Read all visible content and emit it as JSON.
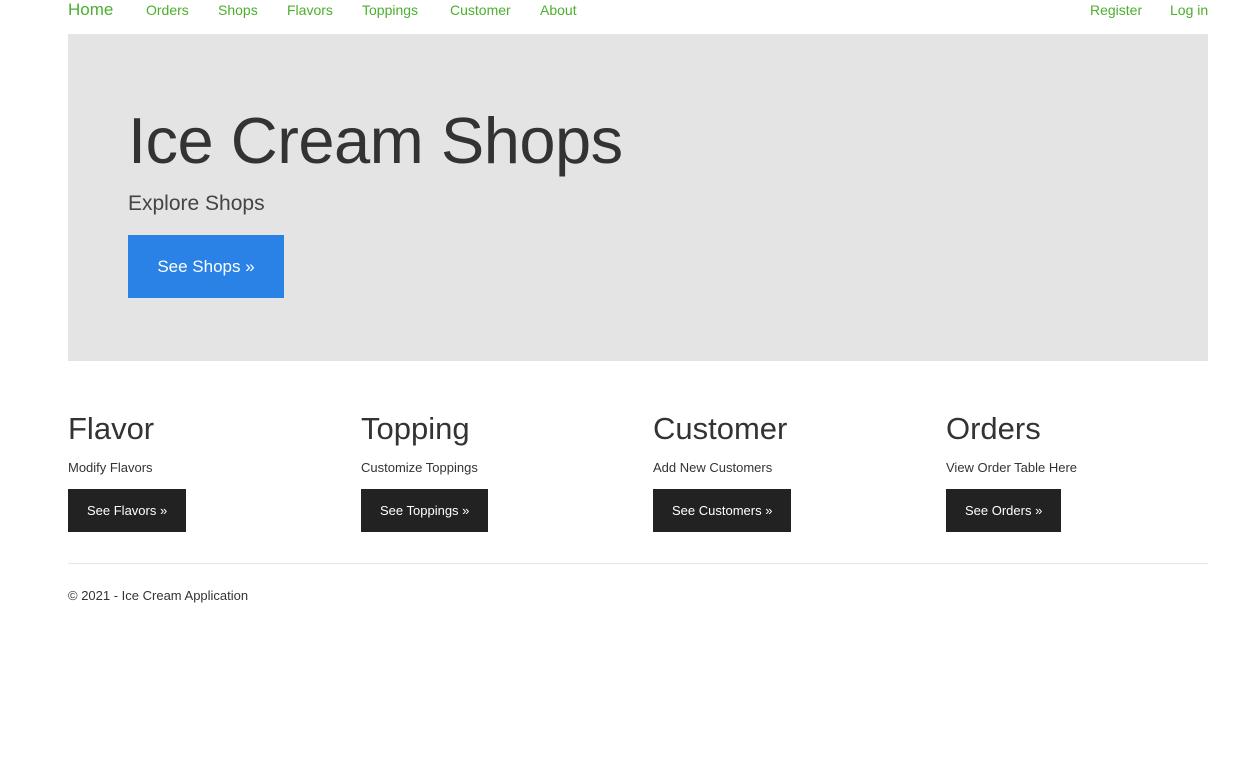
{
  "navbar": {
    "brand": "Home",
    "links": [
      "Orders",
      "Shops",
      "Flavors",
      "Toppings",
      "Customer",
      "About"
    ],
    "right_links": [
      "Register",
      "Log in"
    ],
    "link_color": "#4caf2d"
  },
  "jumbotron": {
    "title": "Ice Cream Shops",
    "lead": "Explore Shops",
    "button_label": "See Shops »",
    "background": "#e4e4e4",
    "button_color": "#2a82e6"
  },
  "features": [
    {
      "title": "Flavor",
      "text": "Modify Flavors",
      "button_label": "See Flavors »"
    },
    {
      "title": "Topping",
      "text": "Customize Toppings",
      "button_label": "See Toppings »"
    },
    {
      "title": "Customer",
      "text": "Add New Customers",
      "button_label": "See Customers »"
    },
    {
      "title": "Orders",
      "text": "View Order Table Here",
      "button_label": "See Orders »"
    }
  ],
  "footer": {
    "text": "© 2021 - Ice Cream Application"
  }
}
